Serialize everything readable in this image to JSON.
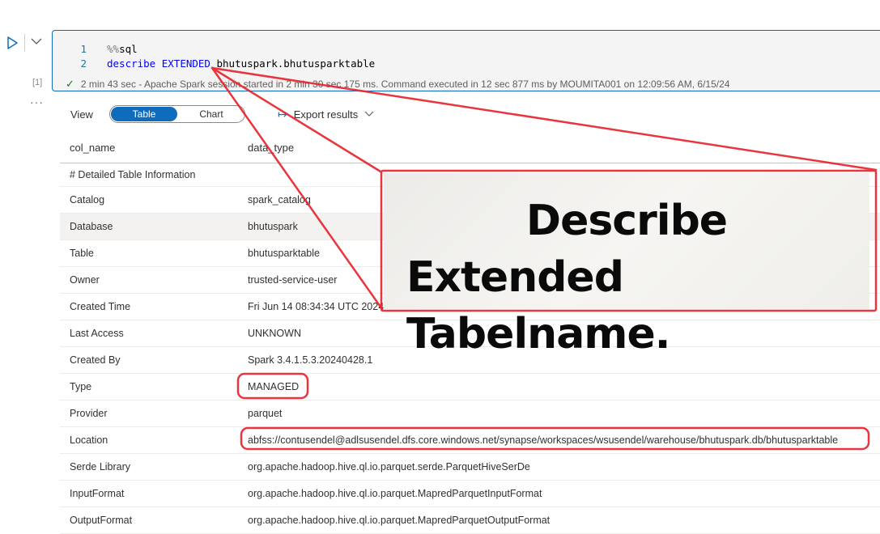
{
  "cell": {
    "execution_count": "[1]",
    "code_lines": [
      {
        "number": "1",
        "magic_prefix": "%%",
        "magic": "sql"
      },
      {
        "number": "2",
        "keyword1": "describe",
        "keyword2": "EXTENDED",
        "target": "bhutuspark.bhutusparktable"
      }
    ],
    "status": {
      "icon": "checkmark-icon",
      "text": "2 min 43 sec - Apache Spark session started in 2 min 30 sec 175 ms. Command executed in 12 sec 877 ms by MOUMITA001 on 12:09:56 AM, 6/15/24"
    }
  },
  "gutter": {
    "run_icon": "run-icon",
    "collapse_icon": "chevron-down-icon",
    "more_icon": "more-icon",
    "more_label": "···"
  },
  "toolbar": {
    "view_label": "View",
    "toggle": {
      "options": [
        "Table",
        "Chart"
      ],
      "selected": "Table"
    },
    "export_label": "Export results",
    "export_icon": "export-icon"
  },
  "table": {
    "columns": [
      "col_name",
      "data_type"
    ],
    "rows": [
      {
        "col_name": "# Detailed Table Information",
        "data_type": ""
      },
      {
        "col_name": "Catalog",
        "data_type": "spark_catalog"
      },
      {
        "col_name": "Database",
        "data_type": "bhutuspark"
      },
      {
        "col_name": "Table",
        "data_type": "bhutusparktable"
      },
      {
        "col_name": "Owner",
        "data_type": "trusted-service-user"
      },
      {
        "col_name": "Created Time",
        "data_type": "Fri Jun 14 08:34:34 UTC 2024"
      },
      {
        "col_name": "Last Access",
        "data_type": "UNKNOWN"
      },
      {
        "col_name": "Created By",
        "data_type": "Spark 3.4.1.5.3.20240428.1"
      },
      {
        "col_name": "Type",
        "data_type": "MANAGED"
      },
      {
        "col_name": "Provider",
        "data_type": "parquet"
      },
      {
        "col_name": "Location",
        "data_type": "abfss://contusendel@adlsusendel.dfs.core.windows.net/synapse/workspaces/wsusendel/warehouse/bhutuspark.db/bhutusparktable"
      },
      {
        "col_name": "Serde Library",
        "data_type": "org.apache.hadoop.hive.ql.io.parquet.serde.ParquetHiveSerDe"
      },
      {
        "col_name": "InputFormat",
        "data_type": "org.apache.hadoop.hive.ql.io.parquet.MapredParquetInputFormat"
      },
      {
        "col_name": "OutputFormat",
        "data_type": "org.apache.hadoop.hive.ql.io.parquet.MapredParquetOutputFormat"
      }
    ],
    "highlighted_row": "Database"
  },
  "annotation": {
    "line1": "Describe",
    "line2": "Extended Tabelname.",
    "color": "#e8202a"
  },
  "colors": {
    "accent": "#0f6cbd",
    "success": "#107c10",
    "annotation_red": "#e8202a"
  }
}
